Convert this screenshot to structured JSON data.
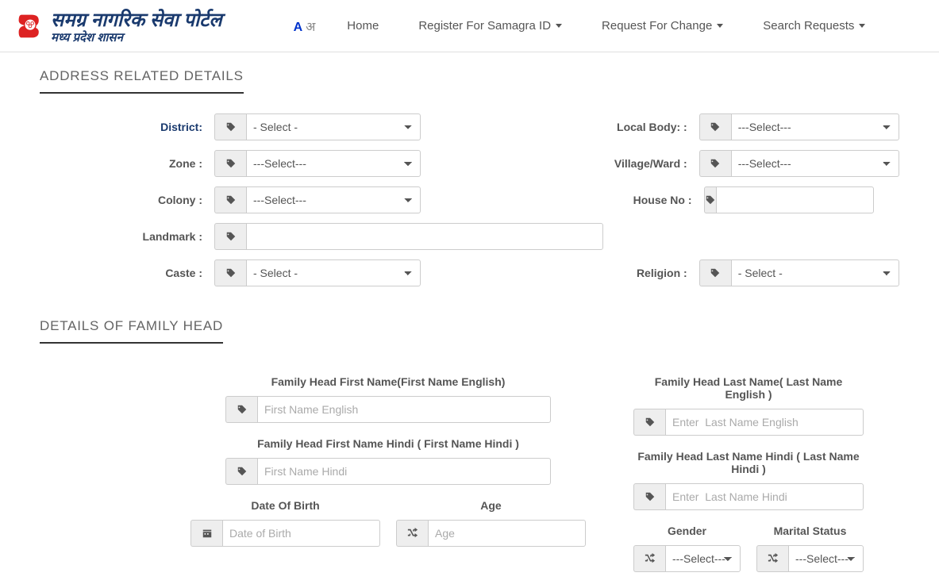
{
  "logo": {
    "line1": "समग्र नागरिक सेवा पोर्टल",
    "line2": "मध्य प्रदेश शासन"
  },
  "lang": {
    "en": "A",
    "hi": "अ"
  },
  "nav": {
    "home": "Home",
    "register": "Register For Samagra ID",
    "request": "Request For Change",
    "search": "Search Requests"
  },
  "section1": {
    "title": "ADDRESS RELATED DETAILS"
  },
  "labels": {
    "district": "District:",
    "localbody": "Local Body: :",
    "zone": "Zone :",
    "village": "Village/Ward :",
    "colony": "Colony :",
    "houseno": "House No :",
    "landmark": "Landmark :",
    "caste": "Caste :",
    "religion": "Religion :"
  },
  "opts": {
    "selectdash": "- Select -",
    "selectdash3": "---Select---"
  },
  "section2": {
    "title": "DETAILS OF FAMILY HEAD"
  },
  "head": {
    "fn_en_label": "Family Head First Name(First Name English)",
    "fn_en_ph": "First Name English",
    "ln_en_label": "Family Head Last Name( Last Name English )",
    "ln_en_ph": "Enter  Last Name English",
    "fn_hi_label": "Family Head First Name Hindi ( First Name Hindi )",
    "fn_hi_ph": "First Name Hindi",
    "ln_hi_label": "Family Head Last Name Hindi ( Last Name Hindi )",
    "ln_hi_ph": "Enter  Last Name Hindi",
    "dob_label": "Date Of Birth",
    "dob_ph": "Date of Birth",
    "age_label": "Age",
    "age_ph": "Age",
    "gender_label": "Gender",
    "marital_label": "Marital Status"
  }
}
